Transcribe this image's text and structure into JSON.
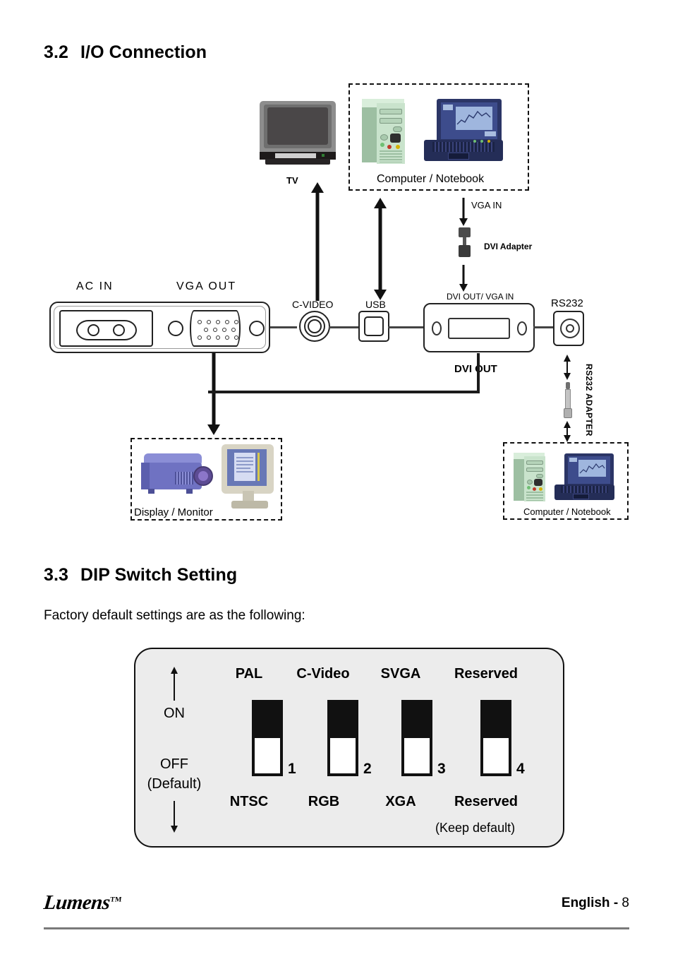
{
  "document": {
    "sections": [
      {
        "number": "3.2",
        "title": "I/O Connection"
      },
      {
        "number": "3.3",
        "title": "DIP Switch Setting"
      }
    ],
    "body_text": "Factory default settings are as the following:",
    "footer": {
      "brand": "Lumens",
      "trademark": "TM",
      "language": "English",
      "separator": "-",
      "page_number": "8"
    }
  },
  "io_diagram": {
    "devices": {
      "tv": "TV",
      "computer_notebook_top": "Computer / Notebook",
      "computer_notebook_bottom": "Computer / Notebook",
      "display_monitor": "Display / Monitor",
      "dvi_adapter": "DVI Adapter",
      "rs232_adapter": "RS232 ADAPTER"
    },
    "ports": {
      "ac_in": "AC  IN",
      "vga_out": "VGA  OUT",
      "c_video": "C-VIDEO",
      "usb": "USB",
      "dvi_out_vga_in": "DVI OUT/ VGA IN",
      "dvi_out": "DVI OUT",
      "rs232": "RS232",
      "vga_in": "VGA IN"
    }
  },
  "dip_switch": {
    "axis": {
      "on_label": "ON",
      "off_label": "OFF",
      "default_label": "(Default)"
    },
    "note": "(Keep default)",
    "switches": [
      {
        "number": "1",
        "on_label": "PAL",
        "off_label": "NTSC",
        "position": "OFF"
      },
      {
        "number": "2",
        "on_label": "C-Video",
        "off_label": "RGB",
        "position": "OFF"
      },
      {
        "number": "3",
        "on_label": "SVGA",
        "off_label": "XGA",
        "position": "OFF"
      },
      {
        "number": "4",
        "on_label": "Reserved",
        "off_label": "Reserved",
        "position": "OFF"
      }
    ]
  }
}
